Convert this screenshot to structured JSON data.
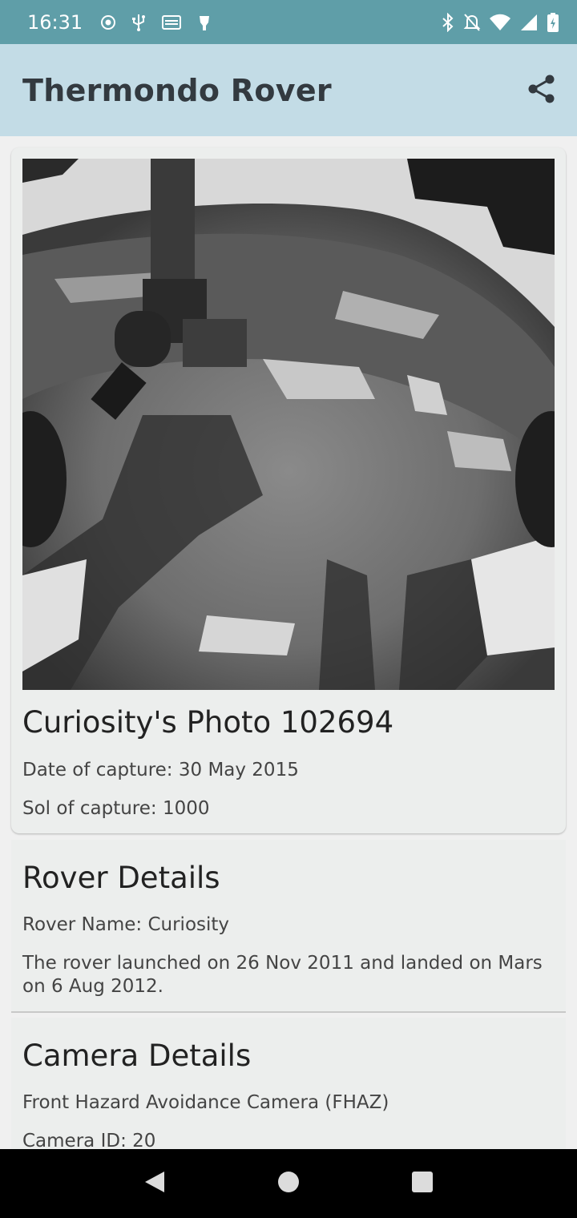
{
  "status_bar": {
    "time": "16:31",
    "left_icons": [
      "radio-icon",
      "usb-icon",
      "cast-icon",
      "pin-icon"
    ],
    "right_icons": [
      "bluetooth-icon",
      "mute-icon",
      "wifi-icon",
      "signal-icon",
      "battery-charging-icon"
    ]
  },
  "app_bar": {
    "title": "Thermondo Rover",
    "share_icon": "share-icon"
  },
  "photo_card": {
    "title": "Curiosity's Photo 102694",
    "date": "Date of capture: 30 May 2015",
    "sol": "Sol of capture: 1000"
  },
  "rover_details": {
    "title": "Rover Details",
    "name": "Rover Name: Curiosity",
    "description": "The rover launched on 26 Nov 2011 and landed on Mars on 6 Aug 2012."
  },
  "camera_details": {
    "title": "Camera Details",
    "camera_name": "Front Hazard Avoidance Camera (FHAZ)",
    "camera_id": "Camera ID: 20"
  },
  "nav_bar": {
    "back_icon": "back-icon",
    "home_icon": "home-icon",
    "recents_icon": "recents-icon"
  },
  "colors": {
    "status_bar": "#5f9ea8",
    "app_bar": "#c3dce6",
    "card": "#eceeed"
  }
}
